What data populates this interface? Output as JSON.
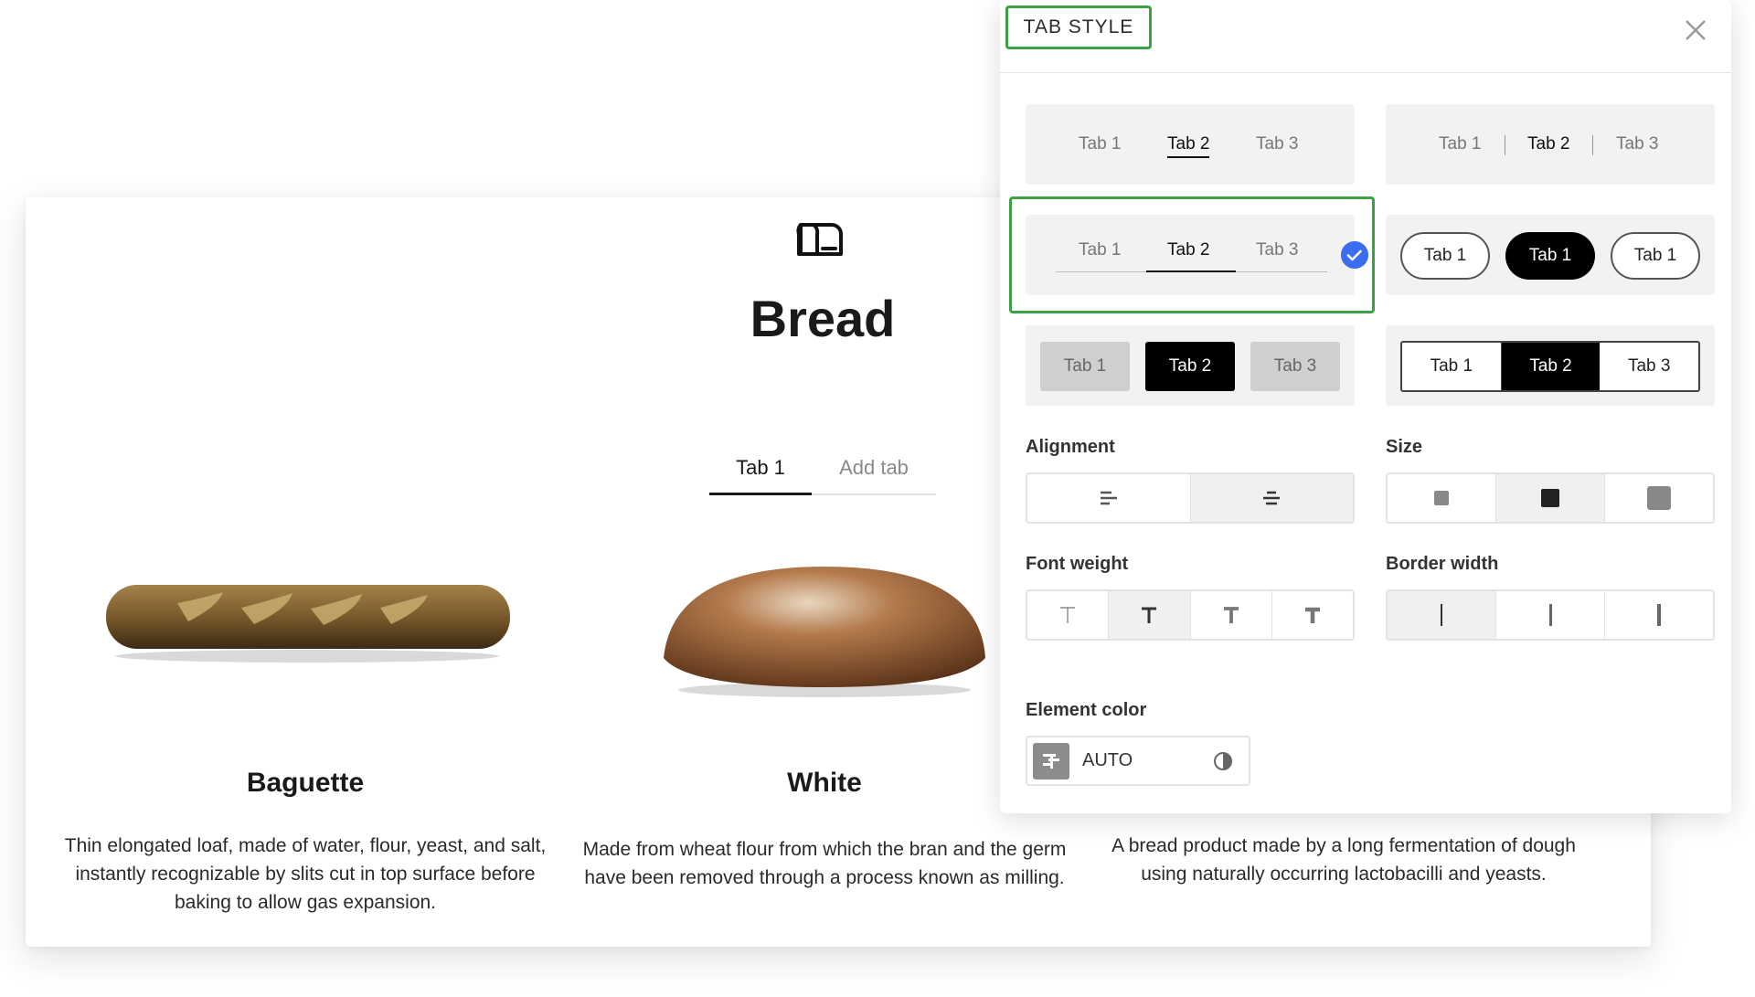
{
  "page": {
    "title": "Bread",
    "tabs": [
      {
        "label": "Tab 1"
      },
      {
        "label": "Add tab"
      }
    ],
    "products": [
      {
        "name": "Baguette",
        "description": "Thin elongated loaf, made of water, flour, yeast, and salt, instantly recognizable by slits cut in top surface before baking to allow gas expansion."
      },
      {
        "name": "White",
        "description": "Made from wheat flour from which the bran and the germ have been removed through a process known as milling."
      },
      {
        "name": "",
        "description": "A bread product made by a long fermentation of dough using naturally occurring lactobacilli and yeasts."
      }
    ]
  },
  "panel": {
    "title": "TAB STYLE",
    "close_icon": "close-icon",
    "styles": {
      "underline": [
        "Tab 1",
        "Tab 2",
        "Tab 3"
      ],
      "divided": [
        "Tab 1",
        "Tab 2",
        "Tab 3"
      ],
      "line": [
        "Tab 1",
        "Tab 2",
        "Tab 3"
      ],
      "pills": [
        "Tab 1",
        "Tab 1",
        "Tab 1"
      ],
      "filled": [
        "Tab 1",
        "Tab 2",
        "Tab 3"
      ],
      "boxed": [
        "Tab 1",
        "Tab 2",
        "Tab 3"
      ]
    },
    "selected_style": "line",
    "alignment": {
      "label": "Alignment",
      "options": [
        "left",
        "center"
      ],
      "selected": "center"
    },
    "size": {
      "label": "Size",
      "options": [
        "small",
        "medium",
        "large"
      ],
      "selected": "medium"
    },
    "font_weight": {
      "label": "Font weight",
      "options": [
        "light",
        "regular",
        "medium",
        "bold"
      ],
      "selected": "regular"
    },
    "border_width": {
      "label": "Border width",
      "options": [
        "thin",
        "medium",
        "thick"
      ],
      "selected": "thin"
    },
    "element_color": {
      "label": "Element color",
      "value": "AUTO"
    }
  },
  "colors": {
    "accent_green": "#3aa344",
    "check_blue": "#3a6df0",
    "active_tab": "#000000"
  }
}
